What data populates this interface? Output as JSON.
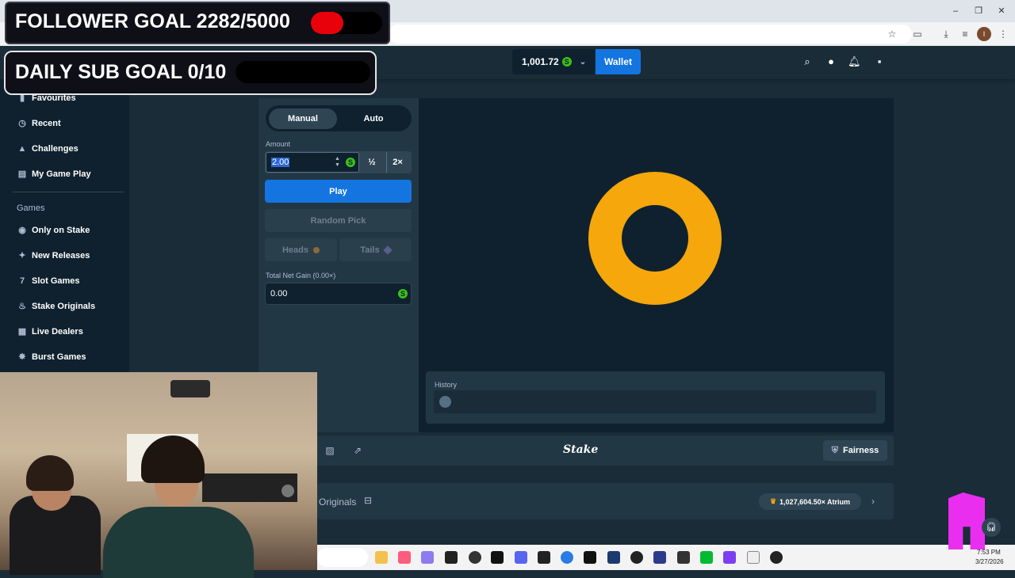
{
  "overlays": {
    "follower_goal_text": "FOLLOWER GOAL 2282/5000",
    "follower_progress": 0.456,
    "sub_goal_text": "DAILY SUB GOAL 0/10",
    "sub_progress": 0
  },
  "header": {
    "balance": "1,001.72",
    "currency_symbol": "S",
    "wallet_label": "Wallet"
  },
  "sidebar": {
    "items": [
      {
        "label": "Favourites",
        "icon": "bookmark-icon"
      },
      {
        "label": "Recent",
        "icon": "clock-icon"
      },
      {
        "label": "Challenges",
        "icon": "challenge-icon"
      },
      {
        "label": "My Game Play",
        "icon": "gameplay-icon"
      }
    ],
    "games_heading": "Games",
    "game_items": [
      {
        "label": "Only on Stake",
        "icon": "stake-icon"
      },
      {
        "label": "New Releases",
        "icon": "sparkle-icon"
      },
      {
        "label": "Slot Games",
        "icon": "slots-icon"
      },
      {
        "label": "Stake Originals",
        "icon": "flame-icon"
      },
      {
        "label": "Live Dealers",
        "icon": "cards-icon"
      },
      {
        "label": "Burst Games",
        "icon": "burst-icon"
      }
    ]
  },
  "controls": {
    "tab_manual": "Manual",
    "tab_auto": "Auto",
    "amount_label": "Amount",
    "amount_value": "2.00",
    "half_label": "½",
    "double_label": "2×",
    "play_label": "Play",
    "random_pick_label": "Random Pick",
    "heads_label": "Heads",
    "tails_label": "Tails",
    "net_gain_label": "Total Net Gain (0.00×)",
    "net_gain_value": "0.00"
  },
  "history": {
    "label": "History"
  },
  "footer": {
    "brand": "Stake",
    "fairness_label": "Fairness",
    "originals_label": "Originals",
    "atrium_badge": "1,027,604.50× Atrium"
  },
  "taskbar": {
    "time": "7:53 PM",
    "date": "3/27/2026"
  },
  "colors": {
    "accent_blue": "#1475e1",
    "coin_orange": "#f5a70b",
    "currency_green": "#3bc117",
    "follower_red": "#e8000a"
  }
}
